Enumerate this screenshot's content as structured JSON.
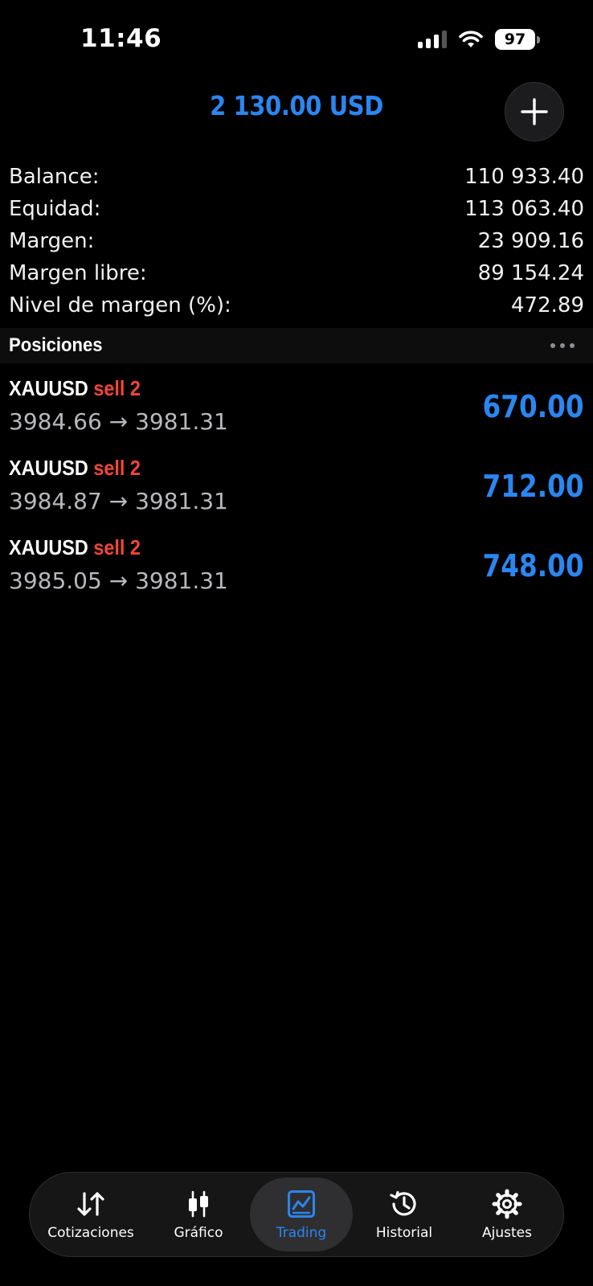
{
  "status_bar": {
    "time": "11:46",
    "battery": "97"
  },
  "header": {
    "total": "2 130.00 USD"
  },
  "summary": [
    {
      "label": "Balance:",
      "value": "110 933.40"
    },
    {
      "label": "Equidad:",
      "value": "113 063.40"
    },
    {
      "label": "Margen:",
      "value": "23 909.16"
    },
    {
      "label": "Margen libre:",
      "value": "89 154.24"
    },
    {
      "label": "Nivel de margen (%):",
      "value": "472.89"
    }
  ],
  "positions_section": {
    "title": "Posiciones"
  },
  "positions": [
    {
      "symbol": "XAUUSD",
      "side": "sell 2",
      "open_price": "3984.66",
      "arrow": "→",
      "current_price": "3981.31",
      "profit": "670.00"
    },
    {
      "symbol": "XAUUSD",
      "side": "sell 2",
      "open_price": "3984.87",
      "arrow": "→",
      "current_price": "3981.31",
      "profit": "712.00"
    },
    {
      "symbol": "XAUUSD",
      "side": "sell 2",
      "open_price": "3985.05",
      "arrow": "→",
      "current_price": "3981.31",
      "profit": "748.00"
    }
  ],
  "tab_bar": {
    "tabs": [
      {
        "label": "Cotizaciones",
        "icon": "arrows-up-down-icon",
        "active": false
      },
      {
        "label": "Gráfico",
        "icon": "candlestick-icon",
        "active": false
      },
      {
        "label": "Trading",
        "icon": "trading-chart-icon",
        "active": true
      },
      {
        "label": "Historial",
        "icon": "history-icon",
        "active": false
      },
      {
        "label": "Ajustes",
        "icon": "gear-icon",
        "active": false
      }
    ]
  },
  "colors": {
    "accent": "#2b86f0",
    "sell": "#f0463c",
    "background": "#000000"
  }
}
